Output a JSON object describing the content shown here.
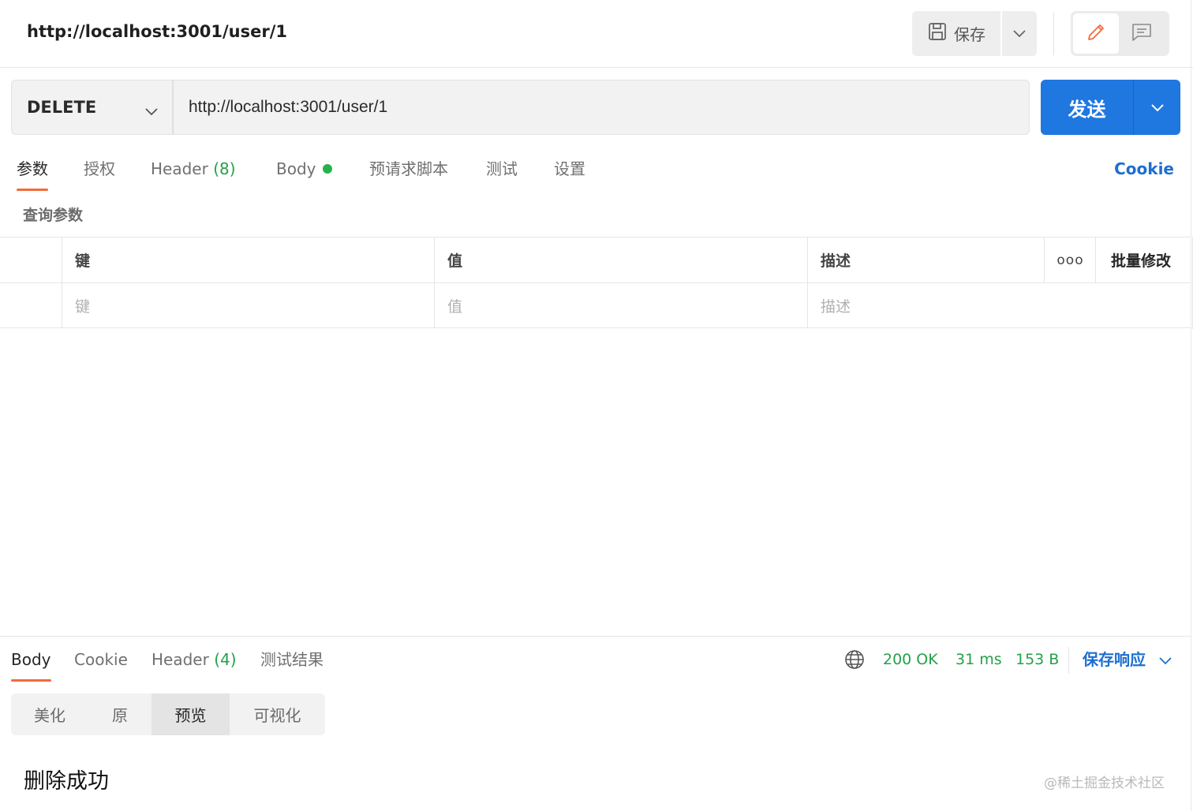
{
  "header": {
    "request_title": "http://localhost:3001/user/1",
    "save_label": "保存"
  },
  "request": {
    "method": "DELETE",
    "url": "http://localhost:3001/user/1",
    "send_label": "发送"
  },
  "request_tabs": [
    {
      "label": "参数",
      "active": true
    },
    {
      "label": "授权"
    },
    {
      "label": "Header",
      "count": "(8)"
    },
    {
      "label": "Body",
      "has_dot": true
    },
    {
      "label": "预请求脚本"
    },
    {
      "label": "测试"
    },
    {
      "label": "设置"
    }
  ],
  "cookie_link": "Cookie",
  "params": {
    "section_label": "查询参数",
    "headers": {
      "key": "键",
      "value": "值",
      "description": "描述",
      "more": "ooo",
      "bulk_edit": "批量修改"
    },
    "placeholders": {
      "key": "键",
      "value": "值",
      "description": "描述"
    }
  },
  "response": {
    "tabs": [
      {
        "label": "Body",
        "active": true
      },
      {
        "label": "Cookie"
      },
      {
        "label": "Header",
        "count": "(4)"
      },
      {
        "label": "测试结果"
      }
    ],
    "status": "200 OK",
    "time": "31 ms",
    "size": "153 B",
    "save_response_label": "保存响应",
    "view_modes": [
      "美化",
      "原",
      "预览",
      "可视化"
    ],
    "active_view_mode": "预览",
    "preview_content": "删除成功"
  },
  "watermark": "@稀土掘金技术社区",
  "colors": {
    "accent": "#1f77e0",
    "tab_indicator": "#f26b3a",
    "success": "#24a148"
  }
}
